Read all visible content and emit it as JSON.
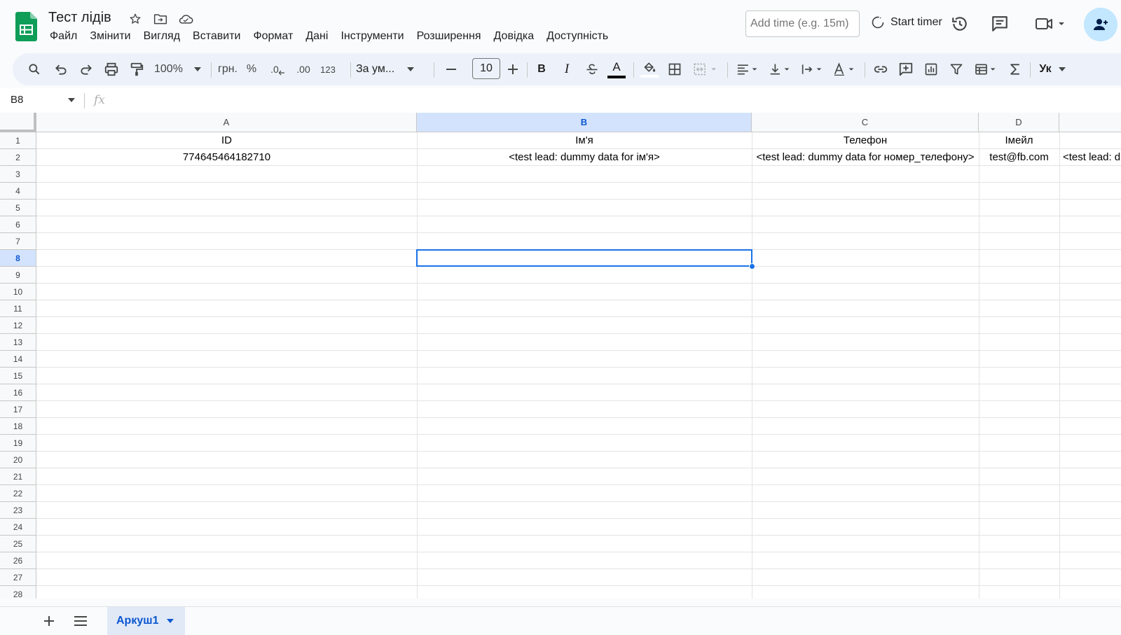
{
  "doc": {
    "title": "Тест лідів"
  },
  "menu": [
    "Файл",
    "Змінити",
    "Вигляд",
    "Вставити",
    "Формат",
    "Дані",
    "Інструменти",
    "Розширення",
    "Довідка",
    "Доступність"
  ],
  "header": {
    "time_placeholder": "Add time (e.g. 15m)",
    "start_timer_label": "Start timer"
  },
  "toolbar": {
    "zoom": "100%",
    "currency": "грн.",
    "percent": "%",
    "decrease_decimal": ".0",
    "increase_decimal": ".00",
    "more_formats": "123",
    "font": "За ум...",
    "font_size": "10",
    "bold": "B",
    "italic": "I",
    "text_color": "A",
    "input_tools": "Ук"
  },
  "formula_bar": {
    "cell_ref": "B8",
    "fx": "fx",
    "value": ""
  },
  "grid": {
    "columns": [
      "A",
      "B",
      "C",
      "D",
      ""
    ],
    "selected_column": "B",
    "selected_row": 8,
    "rows": [
      "1",
      "2",
      "3",
      "4",
      "5",
      "6",
      "7",
      "8",
      "9",
      "10",
      "11",
      "12",
      "13",
      "14",
      "15",
      "16",
      "17",
      "18",
      "19",
      "20",
      "21",
      "22",
      "23",
      "24",
      "25",
      "26",
      "27",
      "28"
    ],
    "cells": {
      "A1": "ID",
      "B1": "Ім'я",
      "C1": "Телефон",
      "D1": "Імейл",
      "A2": "774645464182710",
      "B2": "<test lead: dummy data for ім'я>",
      "C2": "<test lead: dummy data for номер_телефону>",
      "D2": "test@fb.com",
      "E2": "<test lead: d"
    }
  },
  "sheets": {
    "active": "Аркуш1"
  },
  "colors": {
    "accent": "#0b57d0",
    "selection": "#1a73e8",
    "sheets_green": "#0f9d58"
  }
}
